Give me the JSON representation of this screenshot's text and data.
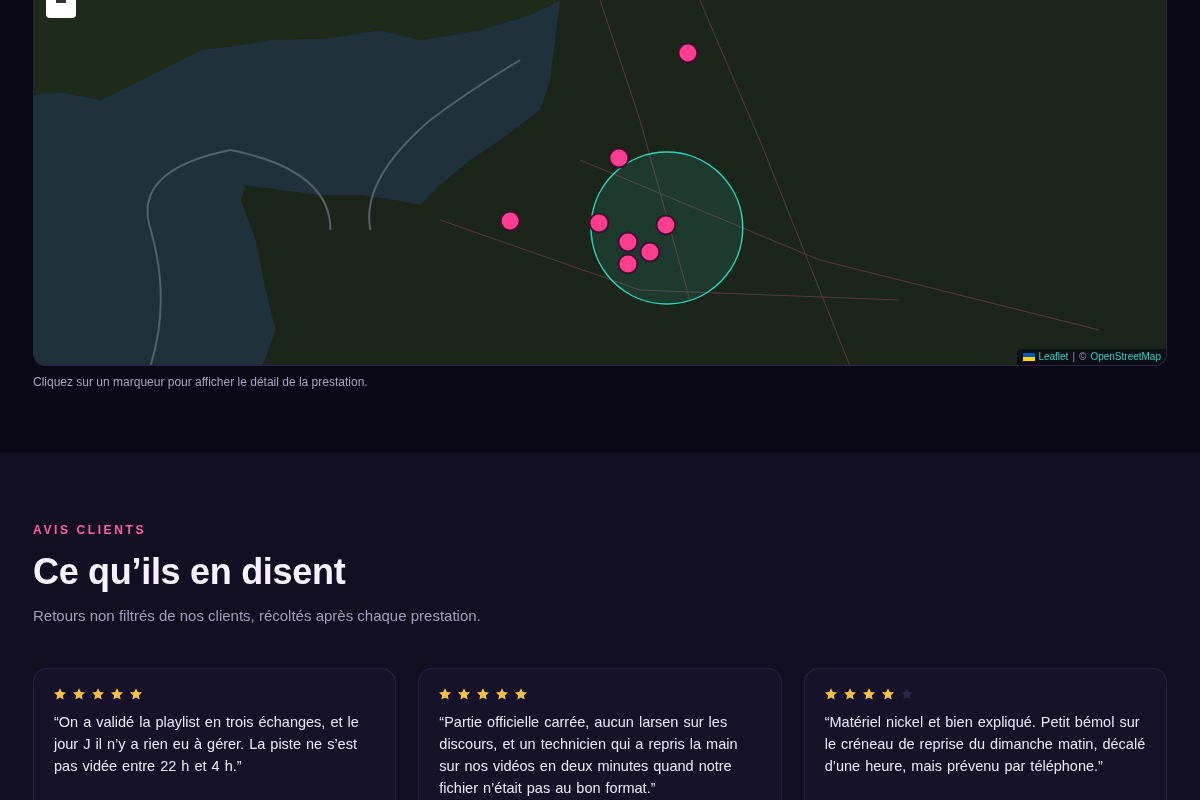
{
  "map": {
    "attribution": {
      "leaflet_link": "Leaflet",
      "separator": "|",
      "copyright": "©",
      "osm_link": "OpenStreetMap"
    },
    "caption": "Cliquez sur un marqueur pour afficher le détail de la prestation."
  },
  "reviews": {
    "eyebrow": "AVIS CLIENTS",
    "title": "Ce qu’ils en disent",
    "subtitle": "Retours non filtrés de nos clients, récoltés après chaque prestation.",
    "items": [
      {
        "stars": 5,
        "quote": "“On a validé la playlist en trois échanges, et le jour J il n’y a rien eu à gérer. La piste ne s’est pas vidée entre 22 h et 4 h.”"
      },
      {
        "stars": 5,
        "quote": "“Partie officielle carrée, aucun larsen sur les discours, et un technicien qui a repris la main sur nos vidéos en deux minutes quand notre fichier n’était pas au bon format.”"
      },
      {
        "stars": 4,
        "quote": "“Matériel nickel et bien expliqué. Petit bémol sur le créneau de reprise du dimanche matin, décalé d’une heure, mais prévenu par téléphone.”"
      }
    ]
  }
}
